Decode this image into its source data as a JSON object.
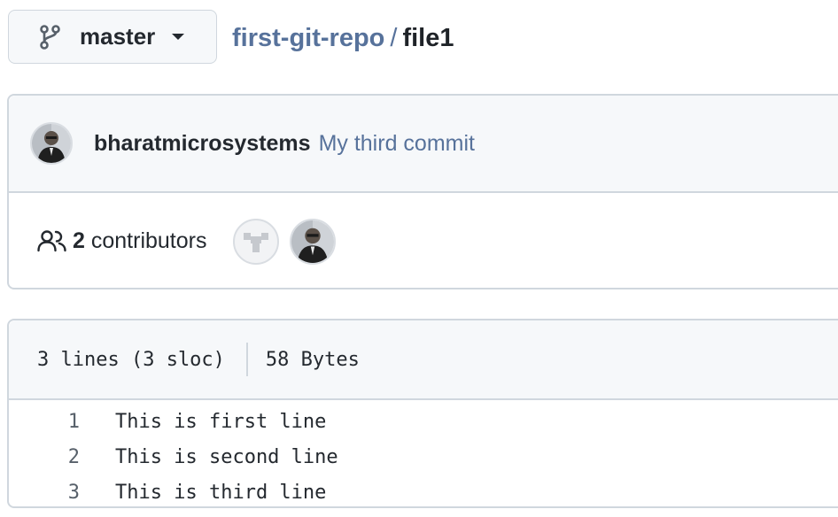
{
  "branch": {
    "name": "master",
    "icon": "git-branch-icon"
  },
  "breadcrumb": {
    "repo": "first-git-repo",
    "separator": "/",
    "file": "file1"
  },
  "commit": {
    "author": "bharatmicrosystems",
    "message": "My third commit"
  },
  "contributors": {
    "count": "2",
    "label": "contributors"
  },
  "file_info": {
    "lines": "3 lines (3 sloc)",
    "size": "58 Bytes"
  },
  "code_lines": [
    {
      "num": "1",
      "text": "This is first line"
    },
    {
      "num": "2",
      "text": "This is second line"
    },
    {
      "num": "3",
      "text": "This is third line"
    }
  ],
  "colors": {
    "link": "#57729b",
    "border": "#d0d7de",
    "header_bg": "#f6f8fa",
    "text": "#24292f"
  }
}
